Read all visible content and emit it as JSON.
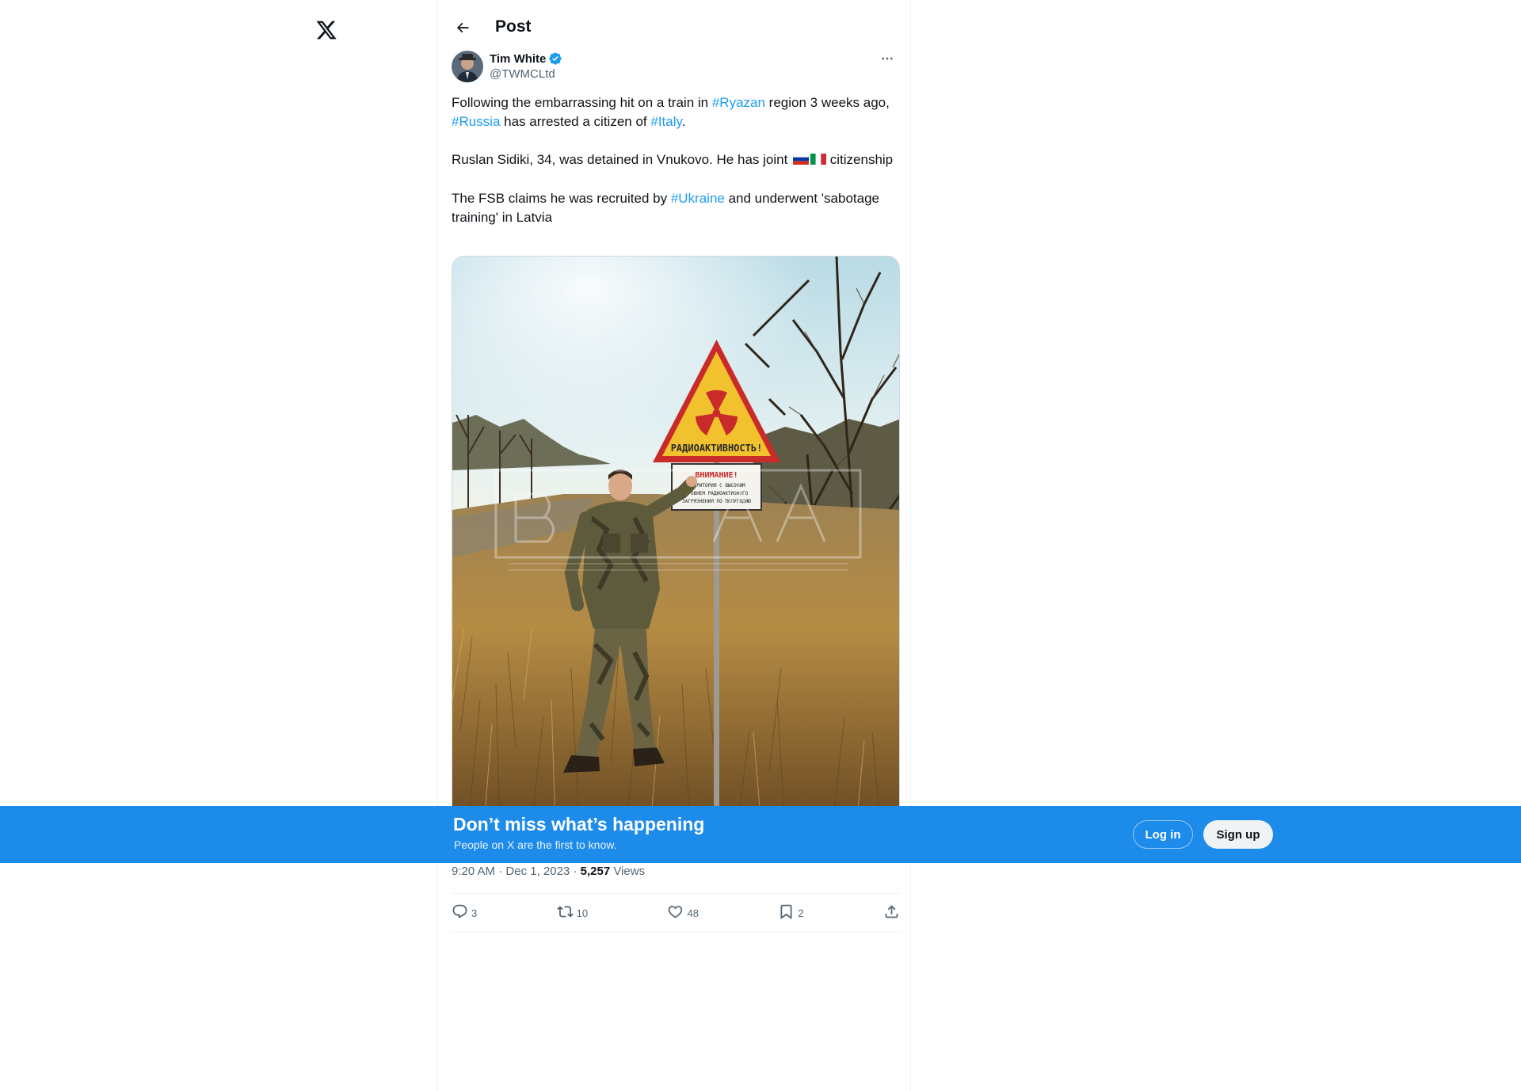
{
  "app": {
    "logo_icon": "x-logo-icon"
  },
  "header": {
    "title": "Post",
    "back_icon": "arrow-left-icon"
  },
  "author": {
    "name": "Tim White",
    "handle": "@TWMCLtd",
    "verified": true,
    "avatar_icon": "user-avatar"
  },
  "tweet": {
    "p1": {
      "t1": "Following the embarrassing hit on a train in ",
      "h1": "#Ryazan",
      "t2": " region 3 weeks ago, ",
      "h2": "#Russia",
      "t3": " has arrested a citizen of ",
      "h3": "#Italy",
      "t4": "."
    },
    "p2": {
      "t1": "Ruslan Sidiki, 34, was detained in Vnukovo. He has joint ",
      "flags": [
        "russia-flag-icon",
        "italy-flag-icon"
      ],
      "t2": " citizenship"
    },
    "p3": {
      "t1": "The FSB claims he was recruited by ",
      "h1": "#Ukraine",
      "t2": " and underwent 'sabotage training' in Latvia"
    }
  },
  "media": {
    "sign_main": "РАДИОАКТИВНОСТЬ!",
    "sign_warning": "ВНИМАНИЕ!",
    "sign_lines": [
      "ТЕРРИТОРИЯ С ВЫСОКИМ",
      "УРОВНЕМ РАДИОАКТИВНОГО",
      "ЗАГРЯЗНЕНИЯ ПО ПОЛУГОДИЮ"
    ]
  },
  "meta": {
    "time": "9:20 AM",
    "separator": " · ",
    "date": "Dec 1, 2023",
    "views_count": "5,257",
    "views_label": " Views"
  },
  "actions": {
    "replies": "3",
    "reposts": "10",
    "likes": "48",
    "bookmarks": "2"
  },
  "banner": {
    "title": "Don’t miss what’s happening",
    "subtitle": "People on X are the first to know.",
    "login": "Log in",
    "signup": "Sign up"
  },
  "colors": {
    "accent": "#1d9bf0",
    "banner": "#1d8bea",
    "text": "#0f1419",
    "muted": "#536471"
  }
}
